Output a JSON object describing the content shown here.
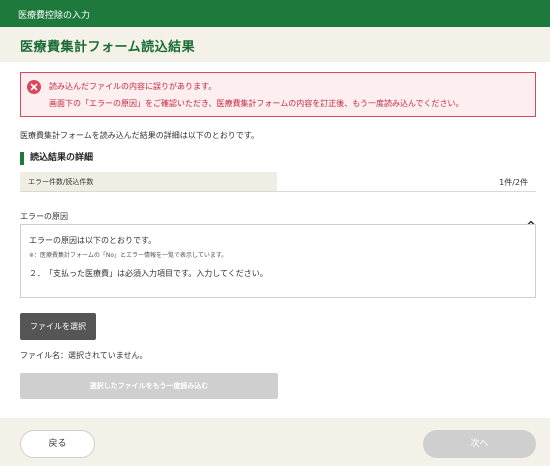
{
  "header": {
    "app_title": "医療費控除の入力",
    "page_title": "医療費集計フォーム読込結果"
  },
  "error_banner": {
    "icon": "error-circle-x-icon",
    "line1": "読み込んだファイルの内容に誤りがあります。",
    "line2": "画面下の「エラーの原因」をご確認いただき、医療費集計フォームの内容を訂正後、もう一度読み込んでください。"
  },
  "intro_text": "医療費集計フォームを読み込んだ結果の詳細は以下のとおりです。",
  "details": {
    "heading": "読込結果の詳細",
    "error_count_label": "エラー件数/読込件数",
    "error_count_value": "1件/2件"
  },
  "cause": {
    "label": "エラーの原因",
    "toggle_icon": "chevron-up-icon",
    "summary": "エラーの原因は以下のとおりです。",
    "note": "※：医療費集計フォームの「No」とエラー情報を一覧で表示しています。",
    "items": [
      "２．　「支払った医療費」は必須入力項目です。入力してください。"
    ]
  },
  "file": {
    "select_button": "ファイルを選択",
    "status": "ファイル名：選択されていません。",
    "reload_button": "選択したファイルをもう一度読み込む"
  },
  "footer": {
    "back_button": "戻る",
    "next_button": "次へ"
  },
  "colors": {
    "brand_green": "#1e7a3c",
    "error_red": "#d9485e",
    "disabled_gray": "#cfcfcf"
  }
}
